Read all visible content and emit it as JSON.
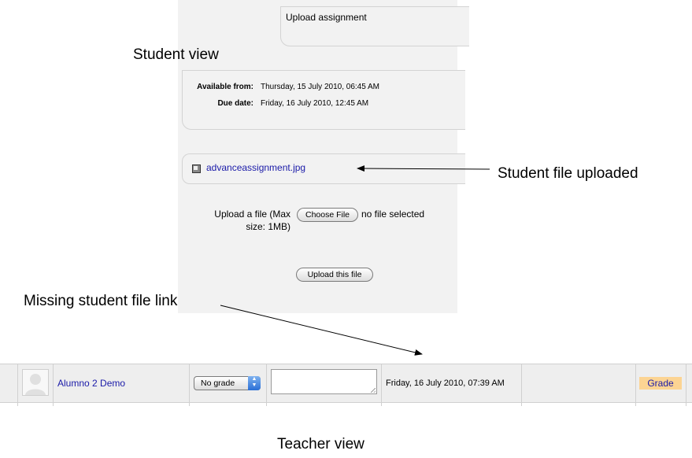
{
  "student_view": {
    "heading": "Student view",
    "upload_heading": "Upload assignment",
    "available_from_label": "Available from:",
    "available_from_value": "Thursday, 15 July 2010, 06:45 AM",
    "due_date_label": "Due date:",
    "due_date_value": "Friday, 16 July 2010, 12:45 AM",
    "uploaded_file_name": "advanceassignment.jpg",
    "upload_label": "Upload a file (Max size: 1MB)",
    "choose_file_button": "Choose File",
    "no_file_text": "no file selected",
    "upload_button": "Upload this file"
  },
  "annotations": {
    "student_file_uploaded": "Student file uploaded",
    "missing_link": "Missing student file link",
    "teacher_view": "Teacher view"
  },
  "teacher_view": {
    "student_name": "Alumno 2 Demo",
    "grade_select_value": "No grade",
    "feedback_value": "",
    "submission_date": "Friday, 16 July 2010, 07:39 AM",
    "grade_button": "Grade"
  },
  "colors": {
    "link": "#1a1aa8",
    "grade_button_bg": "#fcd493",
    "panel_bg": "#f2f2f2"
  }
}
